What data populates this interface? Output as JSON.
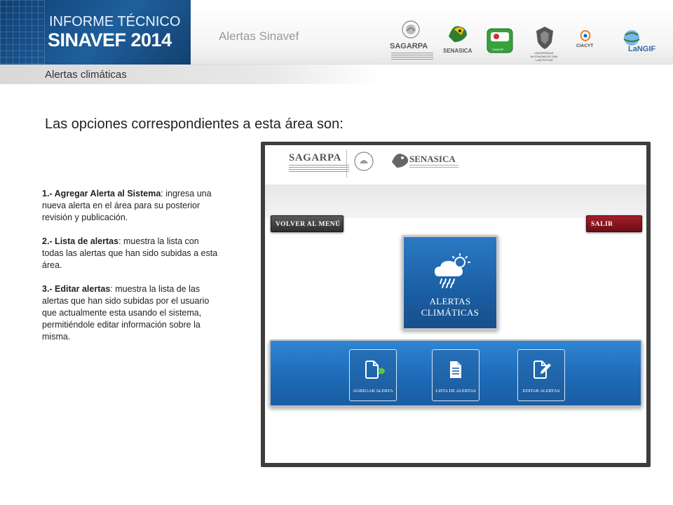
{
  "header": {
    "banner_line1": "INFORME TÉCNICO",
    "banner_line2": "SINAVEF 2014",
    "title": "Alertas Sinavef",
    "section": "Alertas climáticas"
  },
  "logos": [
    {
      "name": "sagarpa",
      "text": "SAGARPA"
    },
    {
      "name": "senasica",
      "text": "SENASICA"
    },
    {
      "name": "sinavef",
      "text": "SINAVEF"
    },
    {
      "name": "uanl",
      "text": "UNIVERSIDAD AUTÓNOMA DE SAN LUIS POTOSÍ"
    },
    {
      "name": "cuacyt",
      "text": "CIACYT"
    },
    {
      "name": "langif",
      "text": "LaNGIF"
    }
  ],
  "content": {
    "heading": "Las opciones correspondientes a esta área son:",
    "items": [
      {
        "term": "1.- Agregar Alerta al Sistema",
        "desc": ": ingresa una nueva alerta en el área para su posterior revisión y publicación."
      },
      {
        "term": "2.- Lista de alertas",
        "desc": ": muestra la lista con todas las alertas que han sido subidas a esta área."
      },
      {
        "term": "3.- Editar alertas",
        "desc": ": muestra la lista de las alertas que han sido subidas por el usuario que actualmente esta usando el sistema, permitiéndole editar información sobre la misma."
      }
    ]
  },
  "app": {
    "logo_sagarpa": "SAGARPA",
    "logo_senasica": "SENASICA",
    "btn_volver": "VOLVER AL MENÚ",
    "btn_salir": "SALIR",
    "main_tile": "ALERTAS CLIMÁTICAS",
    "tiles": [
      {
        "label": "AGREGAR ALERTA",
        "icon": "add-document-icon"
      },
      {
        "label": "LISTA DE ALERTAS",
        "icon": "list-document-icon"
      },
      {
        "label": "EDITAR ALERTAS",
        "icon": "edit-document-icon"
      }
    ],
    "colors": {
      "primary": "#1e6ab8",
      "danger": "#8a141c",
      "dark": "#3a3a3a"
    }
  }
}
